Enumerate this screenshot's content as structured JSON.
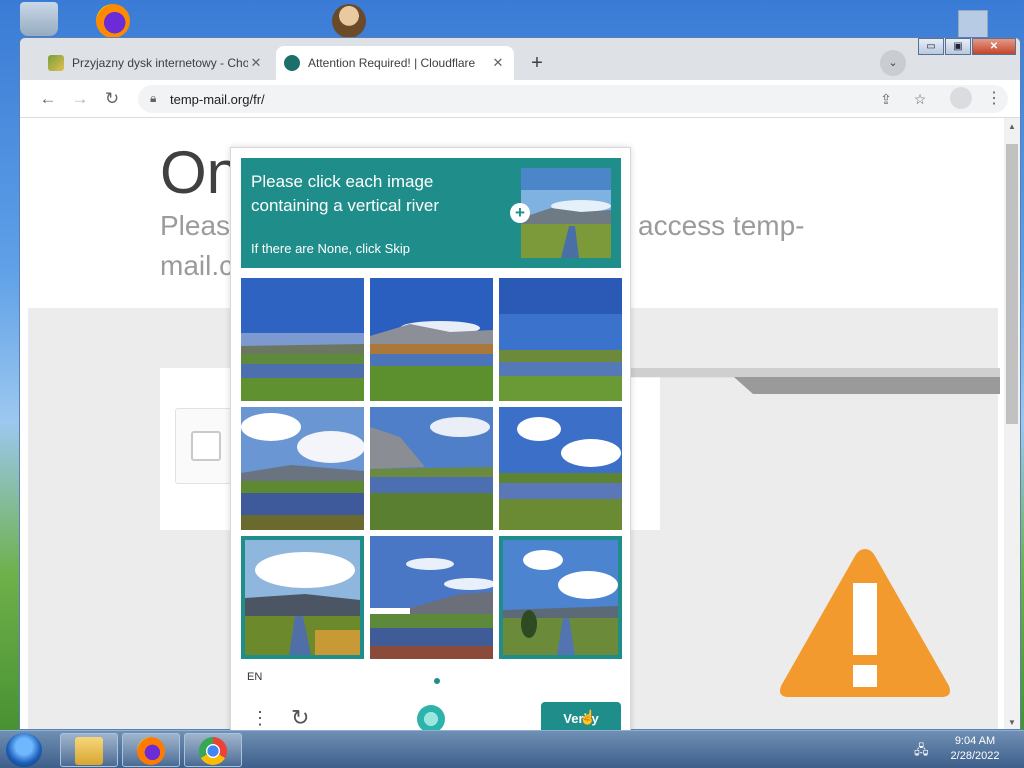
{
  "browser": {
    "tabs": [
      {
        "title": "Przyjazny dysk internetowy - Chom",
        "close": "✕"
      },
      {
        "title": "Attention Required! | Cloudflare",
        "close": "✕"
      }
    ],
    "new_tab": "+",
    "tab_search": "⌄",
    "window_buttons": {
      "minimize": "▭",
      "maximize": "▣",
      "close": "✕"
    },
    "url": "temp-mail.org/fr/"
  },
  "page": {
    "heading": "On",
    "subtitle_left": "Please",
    "subtitle_right": "access temp-",
    "subtitle_line2": "mail.c"
  },
  "captcha": {
    "prompt": "Please click each image containing a vertical river",
    "skip_hint": "If there are None, click Skip",
    "language": "EN",
    "verify_label": "Verify",
    "selected_tiles": [
      7,
      9
    ],
    "accent": "#1f8e8a"
  },
  "taskbar": {
    "time": "9:04 AM",
    "date": "2/28/2022"
  }
}
